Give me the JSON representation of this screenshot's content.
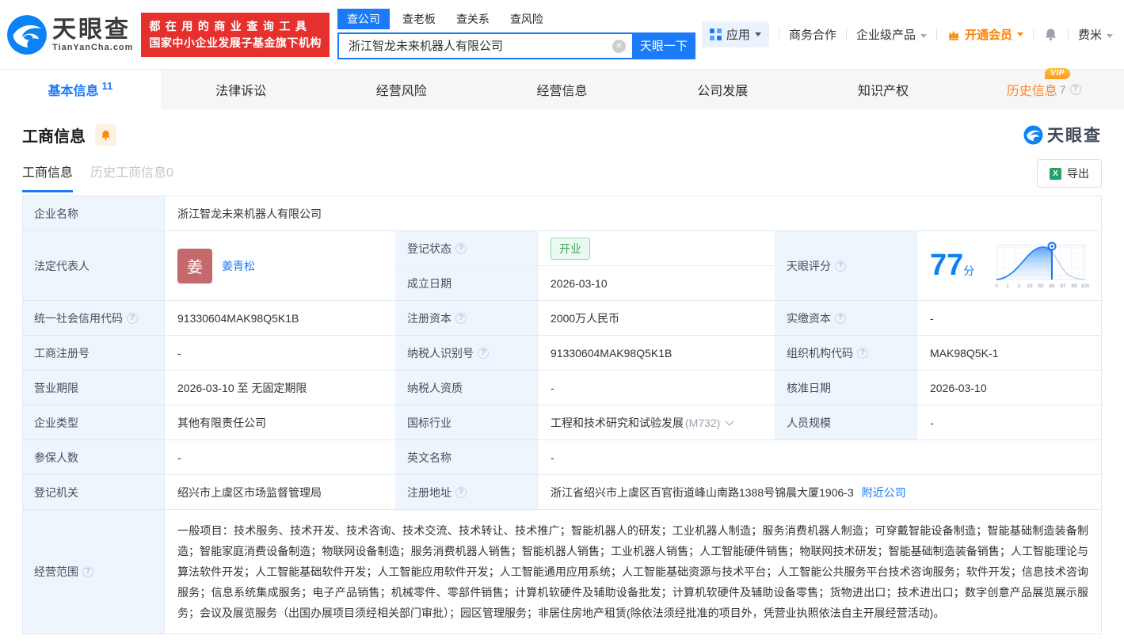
{
  "colors": {
    "accent": "#1a7af8",
    "link": "#0b82f5",
    "orange": "#ff8a00",
    "red": "#e5302e",
    "green": "#3fa55a",
    "label_bg": "#eef5fc"
  },
  "header": {
    "logo": {
      "title": "天眼查",
      "subtitle": "TianYanCha.com"
    },
    "banner": {
      "line1": "都在用的商业查询工具",
      "line2": "国家中小企业发展子基金旗下机构"
    },
    "search": {
      "tabs": [
        "查公司",
        "查老板",
        "查关系",
        "查风险"
      ],
      "value": "浙江智龙未来机器人有限公司",
      "button": "天眼一下"
    },
    "nav": {
      "apps": "应用",
      "cooperation": "商务合作",
      "enterprise": "企业级产品",
      "vip": "开通会员",
      "user": "费米"
    }
  },
  "tabs": {
    "basic": {
      "label": "基本信息",
      "count": "11"
    },
    "legal": {
      "label": "法律诉讼"
    },
    "risk": {
      "label": "经营风险"
    },
    "operation": {
      "label": "经营信息"
    },
    "development": {
      "label": "公司发展"
    },
    "ip": {
      "label": "知识产权"
    },
    "history": {
      "label": "历史信息",
      "count": "7",
      "vip_badge": "VIP"
    }
  },
  "section": {
    "title": "工商信息",
    "subtab_active": "工商信息",
    "subtab_history": "历史工商信息0",
    "export_label": "导出",
    "brand": "天眼查"
  },
  "table": {
    "company": {
      "label": "企业名称",
      "value": "浙江智龙未来机器人有限公司"
    },
    "legal_rep": {
      "label": "法定代表人",
      "avatar": "姜",
      "name": "姜青松"
    },
    "reg_status": {
      "label": "登记状态",
      "value": "开业"
    },
    "establish_date": {
      "label": "成立日期",
      "value": "2026-03-10"
    },
    "score": {
      "label": "天眼评分",
      "value": "77",
      "unit": "分"
    },
    "credit_code": {
      "label": "统一社会信用代码",
      "value": "91330604MAK98Q5K1B"
    },
    "reg_capital": {
      "label": "注册资本",
      "value": "2000万人民币"
    },
    "paid_capital": {
      "label": "实缴资本",
      "value": "-"
    },
    "reg_number": {
      "label": "工商注册号",
      "value": "-"
    },
    "taxpayer_id": {
      "label": "纳税人识别号",
      "value": "91330604MAK98Q5K1B"
    },
    "org_code": {
      "label": "组织机构代码",
      "value": "MAK98Q5K-1"
    },
    "business_term": {
      "label": "营业期限",
      "value": "2026-03-10 至 无固定期限"
    },
    "taxpayer_quality": {
      "label": "纳税人资质",
      "value": "-"
    },
    "approval_date": {
      "label": "核准日期",
      "value": "2026-03-10"
    },
    "company_type": {
      "label": "企业类型",
      "value": "其他有限责任公司"
    },
    "industry": {
      "label": "国标行业",
      "value": "工程和技术研究和试验发展",
      "code": "(M732)"
    },
    "staff_size": {
      "label": "人员规模",
      "value": "-"
    },
    "insured_count": {
      "label": "参保人数",
      "value": "-"
    },
    "english_name": {
      "label": "英文名称",
      "value": "-"
    },
    "reg_authority": {
      "label": "登记机关",
      "value": "绍兴市上虞区市场监督管理局"
    },
    "reg_address": {
      "label": "注册地址",
      "value": "浙江省绍兴市上虞区百官街道峰山南路1388号锦晨大厦1906-3",
      "link": "附近公司"
    },
    "business_scope": {
      "label": "经营范围",
      "value": "一般项目：技术服务、技术开发、技术咨询、技术交流、技术转让、技术推广；智能机器人的研发；工业机器人制造；服务消费机器人制造；可穿戴智能设备制造；智能基础制造装备制造；智能家庭消费设备制造；物联网设备制造；服务消费机器人销售；智能机器人销售；工业机器人销售；人工智能硬件销售；物联网技术研发；智能基础制造装备销售；人工智能理论与算法软件开发；人工智能基础软件开发；人工智能应用软件开发；人工智能通用应用系统；人工智能基础资源与技术平台；人工智能公共服务平台技术咨询服务；软件开发；信息技术咨询服务；信息系统集成服务；电子产品销售；机械零件、零部件销售；计算机软硬件及辅助设备批发；计算机软硬件及辅助设备零售；货物进出口；技术进出口；数字创意产品展览展示服务；会议及展览服务（出国办展项目须经相关部门审批）；园区管理服务；非居住房地产租赁(除依法须经批准的项目外，凭营业执照依法自主开展经营活动)。"
    }
  },
  "score_chart": {
    "type": "area",
    "score": 77,
    "ticks": [
      "0",
      "1",
      "3",
      "15",
      "50",
      "85",
      "97",
      "99",
      "100"
    ]
  }
}
